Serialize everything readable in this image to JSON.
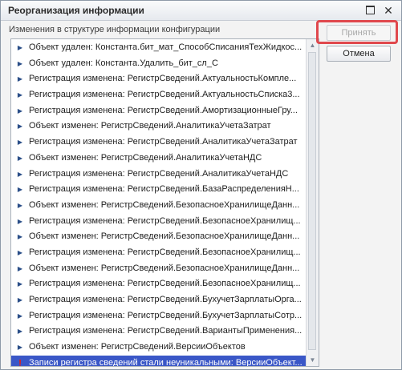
{
  "window": {
    "title": "Реорганизация информации",
    "maximize_label": "",
    "close_label": "✕"
  },
  "subtitle": "Изменения в структуре информации конфигурации",
  "buttons": {
    "accept": "Принять",
    "cancel": "Отмена"
  },
  "colors": {
    "selection": "#3a57c7",
    "highlight_frame": "#e0484d",
    "error_marker": "#e0201a"
  },
  "items": [
    {
      "marker": "▶",
      "text": "Объект удален: Константа.бит_мат_СпособСписанияТехЖидкос..."
    },
    {
      "marker": "▶",
      "text": "Объект удален: Константа.Удалить_бит_сл_С"
    },
    {
      "marker": "▶",
      "text": "Регистрация изменена: РегистрСведений.АктуальностьКомпле..."
    },
    {
      "marker": "▶",
      "text": "Регистрация изменена: РегистрСведений.АктуальностьСписка3..."
    },
    {
      "marker": "▶",
      "text": "Регистрация изменена: РегистрСведений.АмортизационныеГру..."
    },
    {
      "marker": "▶",
      "text": "Объект изменен: РегистрСведений.АналитикаУчетаЗатрат"
    },
    {
      "marker": "▶",
      "text": "Регистрация изменена: РегистрСведений.АналитикаУчетаЗатрат"
    },
    {
      "marker": "▶",
      "text": "Объект изменен: РегистрСведений.АналитикаУчетаНДС"
    },
    {
      "marker": "▶",
      "text": "Регистрация изменена: РегистрСведений.АналитикаУчетаНДС"
    },
    {
      "marker": "▶",
      "text": "Регистрация изменена: РегистрСведений.БазаРаспределенияН..."
    },
    {
      "marker": "▶",
      "text": "Объект изменен: РегистрСведений.БезопасноеХранилищеДанн..."
    },
    {
      "marker": "▶",
      "text": "Регистрация изменена: РегистрСведений.БезопасноеХранилищ..."
    },
    {
      "marker": "▶",
      "text": "Объект изменен: РегистрСведений.БезопасноеХранилищеДанн..."
    },
    {
      "marker": "▶",
      "text": "Регистрация изменена: РегистрСведений.БезопасноеХранилищ..."
    },
    {
      "marker": "▶",
      "text": "Объект изменен: РегистрСведений.БезопасноеХранилищеДанн..."
    },
    {
      "marker": "▶",
      "text": "Регистрация изменена: РегистрСведений.БезопасноеХранилищ..."
    },
    {
      "marker": "▶",
      "text": "Регистрация изменена: РегистрСведений.БухучетЗарплатыОрга..."
    },
    {
      "marker": "▶",
      "text": "Регистрация изменена: РегистрСведений.БухучетЗарплатыСотр..."
    },
    {
      "marker": "▶",
      "text": "Регистрация изменена: РегистрСведений.ВариантыПрименения..."
    },
    {
      "marker": "▶",
      "text": "Объект изменен: РегистрСведений.ВерсииОбъектов"
    },
    {
      "marker": "!",
      "text": "Записи регистра сведений стали неуникальными: ВерсииОбъект...",
      "selected": true
    }
  ]
}
